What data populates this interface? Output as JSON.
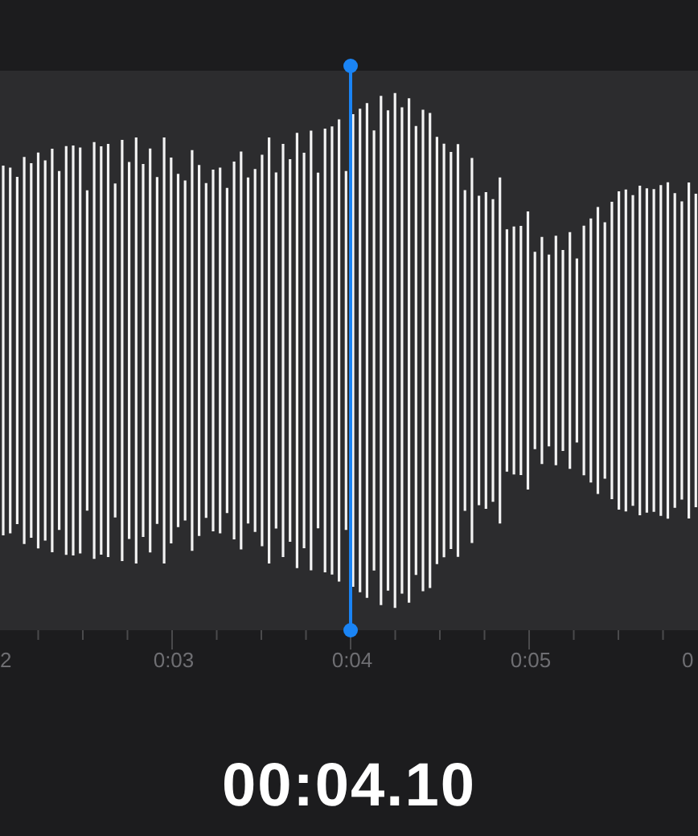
{
  "timeline": {
    "labels": [
      {
        "text": "2",
        "kind": "cut_start"
      },
      {
        "text": "0:03",
        "kind": "full"
      },
      {
        "text": "0:04",
        "kind": "full"
      },
      {
        "text": "0:05",
        "kind": "full"
      },
      {
        "text": "0",
        "kind": "cut_end"
      }
    ]
  },
  "time": "00:04.10"
}
